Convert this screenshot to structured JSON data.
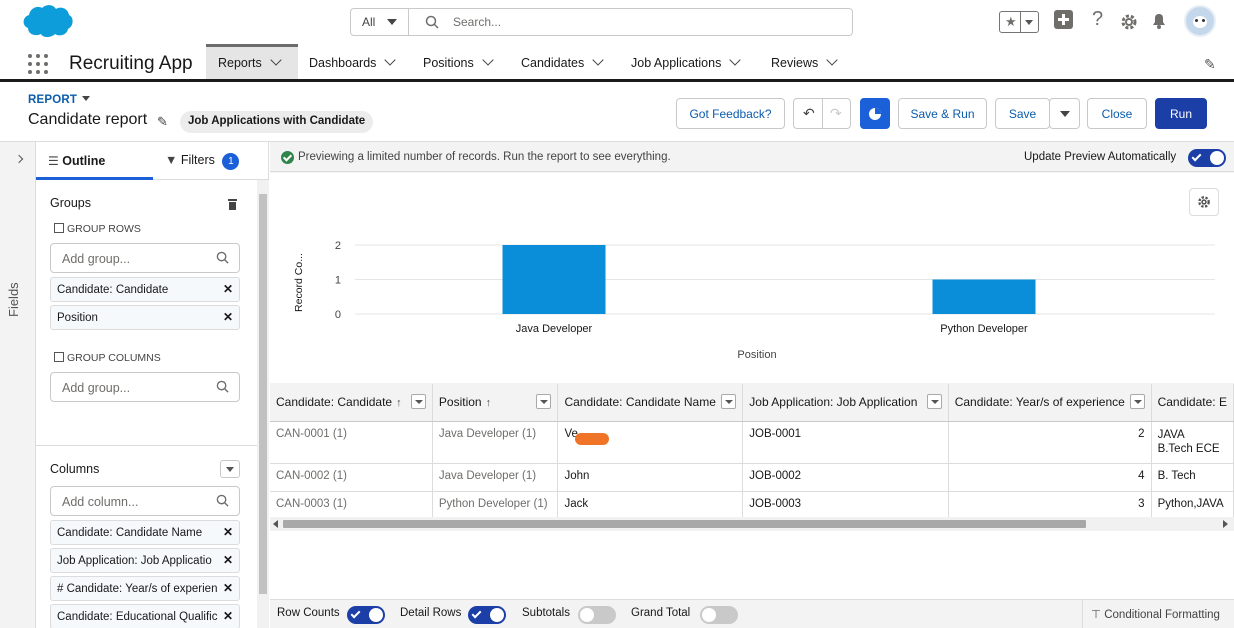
{
  "header": {
    "search_scope": "All",
    "search_placeholder": "Search...",
    "icons": [
      "star-icon",
      "add-icon",
      "help-icon",
      "setup-gear-icon",
      "notifications-bell-icon",
      "avatar"
    ]
  },
  "nav": {
    "app_name": "Recruiting App",
    "tabs": [
      {
        "label": "Reports",
        "active": true
      },
      {
        "label": "Dashboards"
      },
      {
        "label": "Positions"
      },
      {
        "label": "Candidates"
      },
      {
        "label": "Job Applications"
      },
      {
        "label": "Reviews"
      }
    ]
  },
  "report_header": {
    "kind": "REPORT",
    "title": "Candidate report",
    "report_type": "Job Applications with Candidate",
    "buttons": {
      "feedback": "Got Feedback?",
      "save_run": "Save & Run",
      "save": "Save",
      "close": "Close",
      "run": "Run"
    }
  },
  "left_panel": {
    "fields_label": "Fields",
    "tab_outline": "Outline",
    "tab_filters": "Filters",
    "filters_count": "1",
    "groups_heading": "Groups",
    "group_rows_label": "GROUP ROWS",
    "add_group_placeholder": "Add group...",
    "group_rows": [
      "Candidate: Candidate",
      "Position"
    ],
    "group_columns_label": "GROUP COLUMNS",
    "columns_heading": "Columns",
    "add_column_placeholder": "Add column...",
    "columns": [
      "Candidate: Candidate Name",
      "Job Application: Job Applicatio",
      "# Candidate: Year/s of experien",
      "Candidate: Educational Qualific"
    ]
  },
  "preview": {
    "banner": "Previewing a limited number of records. Run the report to see everything.",
    "update_auto_label": "Update Preview Automatically",
    "update_auto_on": true
  },
  "chart_data": {
    "type": "bar",
    "categories": [
      "Java Developer",
      "Python Developer"
    ],
    "values": [
      2,
      1
    ],
    "xlabel": "Position",
    "ylabel": "Record Co...",
    "ylim": [
      0,
      2
    ],
    "yticks": [
      0,
      1,
      2
    ],
    "grid": true,
    "bar_color": "#0b8ed9"
  },
  "table": {
    "columns": [
      {
        "label": "Candidate: Candidate",
        "sort": "↑"
      },
      {
        "label": "Position",
        "sort": "↑"
      },
      {
        "label": "Candidate: Candidate Name"
      },
      {
        "label": "Job Application: Job Application"
      },
      {
        "label": "Candidate: Year/s of experience"
      },
      {
        "label": "Candidate: E"
      }
    ],
    "rows": [
      [
        "CAN-0001 (1)",
        "Java Developer (1)",
        "Ve",
        "JOB-0001",
        "2",
        "JAVA"
      ],
      [
        "CAN-0002 (1)",
        "Java Developer (1)",
        "John",
        "JOB-0002",
        "4",
        "B. Tech"
      ],
      [
        "CAN-0003 (1)",
        "Python Developer (1)",
        "Jack",
        "JOB-0003",
        "3",
        "Python,JAVA"
      ]
    ],
    "row1_extra": "B.Tech ECE"
  },
  "footer": {
    "row_counts": "Row Counts",
    "detail_rows": "Detail Rows",
    "subtotals": "Subtotals",
    "grand_total": "Grand Total",
    "conditional_formatting": "Conditional Formatting"
  },
  "colors": {
    "brand": "#1b3fa6",
    "bar": "#0b8ed9",
    "link": "#0b5cab",
    "success": "#2e844a"
  }
}
